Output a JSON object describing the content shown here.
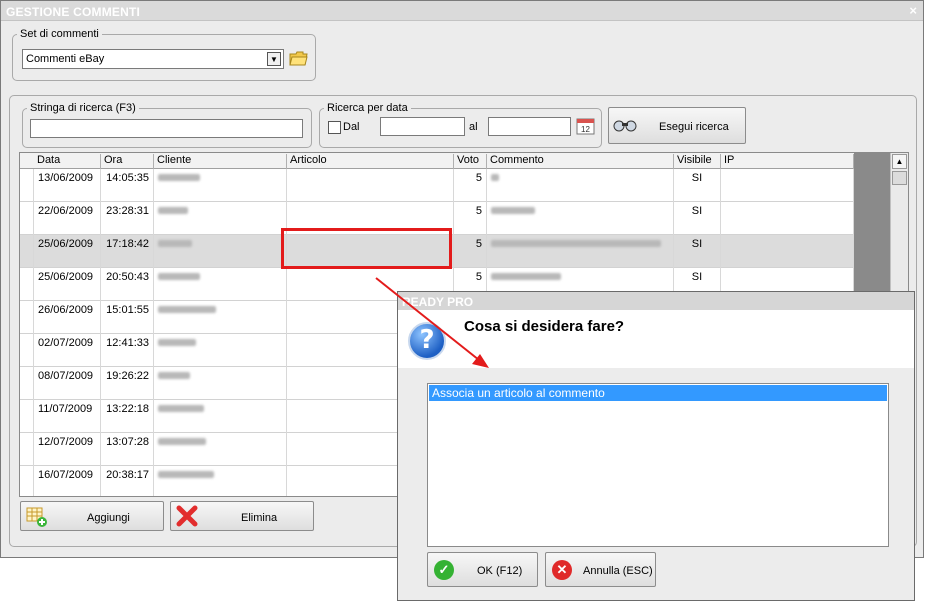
{
  "window": {
    "title": "GESTIONE COMMENTI",
    "close_glyph": "×"
  },
  "set": {
    "legend": "Set di commenti",
    "selected": "Commenti eBay",
    "dropdown_icon": "chevron-down-icon",
    "folder_icon": "folder-icon"
  },
  "search": {
    "string_legend": "Stringa di ricerca (F3)",
    "string_value": "",
    "date_legend": "Ricerca per data",
    "dal_label": "Dal",
    "al_label": "al",
    "date_from": "",
    "date_to": "",
    "calendar_icon": "calendar-icon",
    "button_label": "Esegui ricerca",
    "button_icon": "binoculars-icon"
  },
  "grid": {
    "headers": [
      "Data",
      "Ora",
      "Cliente",
      "Articolo",
      "Voto",
      "Commento",
      "Visibile",
      "IP"
    ],
    "rows": [
      {
        "data": "13/06/2009",
        "ora": "14:05:35",
        "voto": "5",
        "visibile": "SI"
      },
      {
        "data": "22/06/2009",
        "ora": "23:28:31",
        "voto": "5",
        "visibile": "SI"
      },
      {
        "data": "25/06/2009",
        "ora": "17:18:42",
        "voto": "5",
        "visibile": "SI"
      },
      {
        "data": "25/06/2009",
        "ora": "20:50:43",
        "voto": "5",
        "visibile": "SI"
      },
      {
        "data": "26/06/2009",
        "ora": "15:01:55",
        "voto": "",
        "visibile": ""
      },
      {
        "data": "02/07/2009",
        "ora": "12:41:33",
        "voto": "",
        "visibile": ""
      },
      {
        "data": "08/07/2009",
        "ora": "19:26:22",
        "voto": "",
        "visibile": ""
      },
      {
        "data": "11/07/2009",
        "ora": "13:22:18",
        "voto": "",
        "visibile": ""
      },
      {
        "data": "12/07/2009",
        "ora": "13:07:28",
        "voto": "",
        "visibile": ""
      },
      {
        "data": "16/07/2009",
        "ora": "20:38:17",
        "voto": "",
        "visibile": ""
      }
    ]
  },
  "actions": {
    "add_label": "Aggiungi",
    "add_icon": "add-grid-icon",
    "delete_label": "Elimina",
    "delete_icon": "delete-x-icon"
  },
  "dialog": {
    "title": "READY PRO",
    "question": "Cosa si desidera fare?",
    "question_icon": "question-icon",
    "options": [
      "Associa un articolo al commento"
    ],
    "ok_label": "OK (F12)",
    "cancel_label": "Annulla (ESC)",
    "ok_glyph": "✓",
    "cancel_glyph": "✕"
  },
  "annotation": {
    "color": "#e31b1b"
  }
}
